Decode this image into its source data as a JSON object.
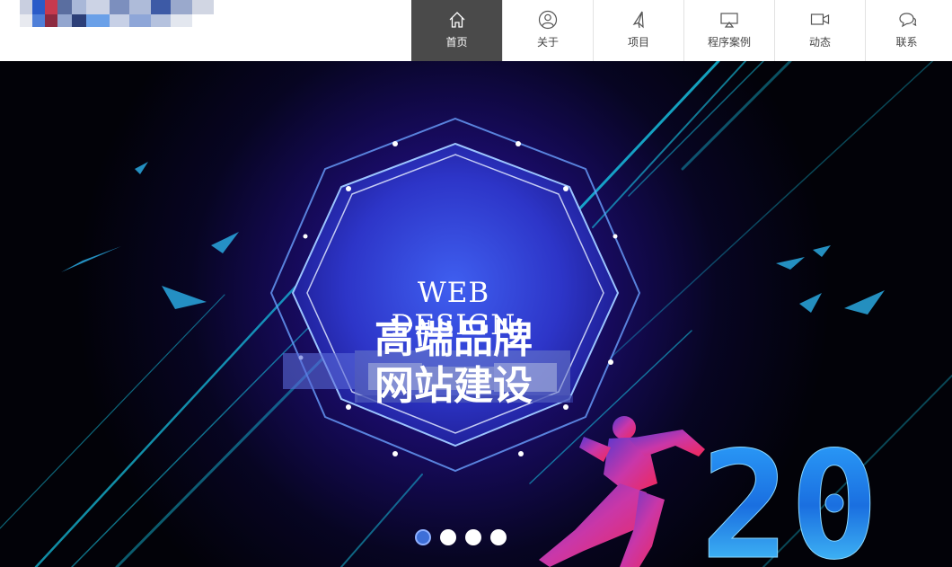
{
  "nav": {
    "items": [
      {
        "label": "首页",
        "icon": "home-icon",
        "active": true
      },
      {
        "label": "关于",
        "icon": "user-icon",
        "active": false
      },
      {
        "label": "项目",
        "icon": "paper-plane-icon",
        "active": false
      },
      {
        "label": "程序案例",
        "icon": "screen-icon",
        "active": false
      },
      {
        "label": "动态",
        "icon": "video-icon",
        "active": false
      },
      {
        "label": "联系",
        "icon": "chat-icon",
        "active": false
      }
    ]
  },
  "banner": {
    "title_en": "WEB DESIGN",
    "title_cn_line1": "高端品牌",
    "title_cn_line2": "网站建设",
    "corner_number": "20",
    "slide_count": 4,
    "active_slide": 1
  },
  "colors": {
    "nav_active_bg": "#4a4a4a",
    "banner_bg": "#05050f",
    "accent_blue": "#3e6fd8",
    "line_cyan": "#18c8e8"
  }
}
